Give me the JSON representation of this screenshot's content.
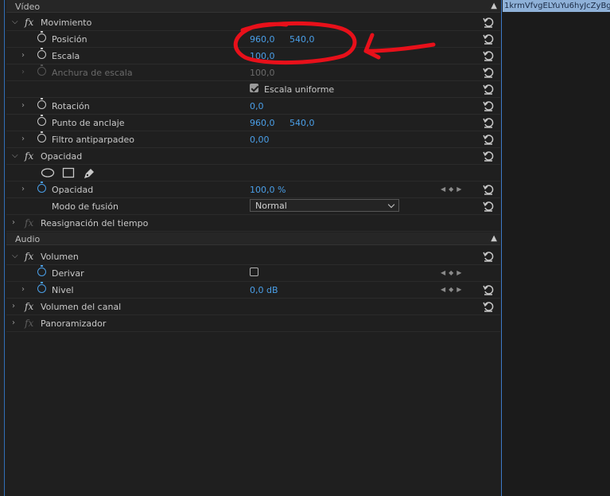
{
  "timeline": {
    "clip_name": "1krmVfvgELYuYu6hyJcZyBg"
  },
  "sections": {
    "video": "Vídeo",
    "audio": "Audio"
  },
  "movimiento": {
    "title": "Movimiento",
    "posicion": {
      "label": "Posición",
      "x": "960,0",
      "y": "540,0"
    },
    "escala": {
      "label": "Escala",
      "value": "100,0"
    },
    "anchura": {
      "label": "Anchura de escala",
      "value": "100,0"
    },
    "uniforme": {
      "label": "Escala uniforme",
      "checked": true
    },
    "rotacion": {
      "label": "Rotación",
      "value": "0,0"
    },
    "anclaje": {
      "label": "Punto de anclaje",
      "x": "960,0",
      "y": "540,0"
    },
    "antiparpadeo": {
      "label": "Filtro antiparpadeo",
      "value": "0,00"
    }
  },
  "opacidad": {
    "title": "Opacidad",
    "opacidad": {
      "label": "Opacidad",
      "value": "100,0 %"
    },
    "fusion": {
      "label": "Modo de fusión",
      "value": "Normal"
    }
  },
  "reasignacion": {
    "title": "Reasignación del tiempo"
  },
  "volumen": {
    "title": "Volumen",
    "derivar": {
      "label": "Derivar",
      "checked": false
    },
    "nivel": {
      "label": "Nivel",
      "value": "0,0 dB"
    }
  },
  "volumen_canal": {
    "title": "Volumen del canal"
  },
  "panoramizador": {
    "title": "Panoramizador"
  },
  "icons": {
    "reset": "reset-icon",
    "stopwatch": "stopwatch-icon",
    "annotation": "red-circle-arrow"
  },
  "colors": {
    "value_blue": "#4a9fe8",
    "annotation_red": "#e8101a",
    "panel_bg": "#1f1f1f"
  }
}
